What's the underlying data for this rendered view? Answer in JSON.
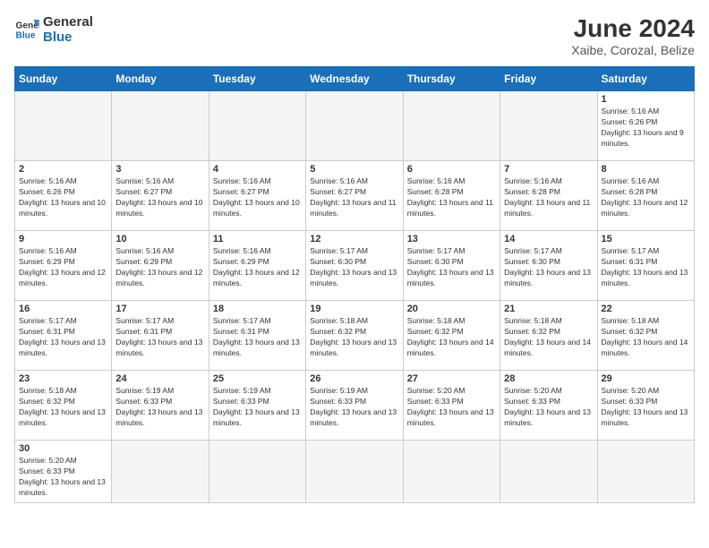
{
  "logo": {
    "line1": "General",
    "line2": "Blue"
  },
  "title": "June 2024",
  "subtitle": "Xaibe, Corozal, Belize",
  "weekdays": [
    "Sunday",
    "Monday",
    "Tuesday",
    "Wednesday",
    "Thursday",
    "Friday",
    "Saturday"
  ],
  "weeks": [
    [
      {
        "day": "",
        "empty": true
      },
      {
        "day": "",
        "empty": true
      },
      {
        "day": "",
        "empty": true
      },
      {
        "day": "",
        "empty": true
      },
      {
        "day": "",
        "empty": true
      },
      {
        "day": "",
        "empty": true
      },
      {
        "day": "1",
        "sunrise": "5:16 AM",
        "sunset": "6:26 PM",
        "daylight": "13 hours and 9 minutes."
      }
    ],
    [
      {
        "day": "2",
        "sunrise": "5:16 AM",
        "sunset": "6:26 PM",
        "daylight": "13 hours and 10 minutes."
      },
      {
        "day": "3",
        "sunrise": "5:16 AM",
        "sunset": "6:27 PM",
        "daylight": "13 hours and 10 minutes."
      },
      {
        "day": "4",
        "sunrise": "5:16 AM",
        "sunset": "6:27 PM",
        "daylight": "13 hours and 10 minutes."
      },
      {
        "day": "5",
        "sunrise": "5:16 AM",
        "sunset": "6:27 PM",
        "daylight": "13 hours and 11 minutes."
      },
      {
        "day": "6",
        "sunrise": "5:16 AM",
        "sunset": "6:28 PM",
        "daylight": "13 hours and 11 minutes."
      },
      {
        "day": "7",
        "sunrise": "5:16 AM",
        "sunset": "6:28 PM",
        "daylight": "13 hours and 11 minutes."
      },
      {
        "day": "8",
        "sunrise": "5:16 AM",
        "sunset": "6:28 PM",
        "daylight": "13 hours and 12 minutes."
      }
    ],
    [
      {
        "day": "9",
        "sunrise": "5:16 AM",
        "sunset": "6:29 PM",
        "daylight": "13 hours and 12 minutes."
      },
      {
        "day": "10",
        "sunrise": "5:16 AM",
        "sunset": "6:29 PM",
        "daylight": "13 hours and 12 minutes."
      },
      {
        "day": "11",
        "sunrise": "5:16 AM",
        "sunset": "6:29 PM",
        "daylight": "13 hours and 12 minutes."
      },
      {
        "day": "12",
        "sunrise": "5:17 AM",
        "sunset": "6:30 PM",
        "daylight": "13 hours and 13 minutes."
      },
      {
        "day": "13",
        "sunrise": "5:17 AM",
        "sunset": "6:30 PM",
        "daylight": "13 hours and 13 minutes."
      },
      {
        "day": "14",
        "sunrise": "5:17 AM",
        "sunset": "6:30 PM",
        "daylight": "13 hours and 13 minutes."
      },
      {
        "day": "15",
        "sunrise": "5:17 AM",
        "sunset": "6:31 PM",
        "daylight": "13 hours and 13 minutes."
      }
    ],
    [
      {
        "day": "16",
        "sunrise": "5:17 AM",
        "sunset": "6:31 PM",
        "daylight": "13 hours and 13 minutes."
      },
      {
        "day": "17",
        "sunrise": "5:17 AM",
        "sunset": "6:31 PM",
        "daylight": "13 hours and 13 minutes."
      },
      {
        "day": "18",
        "sunrise": "5:17 AM",
        "sunset": "6:31 PM",
        "daylight": "13 hours and 13 minutes."
      },
      {
        "day": "19",
        "sunrise": "5:18 AM",
        "sunset": "6:32 PM",
        "daylight": "13 hours and 13 minutes."
      },
      {
        "day": "20",
        "sunrise": "5:18 AM",
        "sunset": "6:32 PM",
        "daylight": "13 hours and 14 minutes."
      },
      {
        "day": "21",
        "sunrise": "5:18 AM",
        "sunset": "6:32 PM",
        "daylight": "13 hours and 14 minutes."
      },
      {
        "day": "22",
        "sunrise": "5:18 AM",
        "sunset": "6:32 PM",
        "daylight": "13 hours and 14 minutes."
      }
    ],
    [
      {
        "day": "23",
        "sunrise": "5:18 AM",
        "sunset": "6:32 PM",
        "daylight": "13 hours and 13 minutes."
      },
      {
        "day": "24",
        "sunrise": "5:19 AM",
        "sunset": "6:33 PM",
        "daylight": "13 hours and 13 minutes."
      },
      {
        "day": "25",
        "sunrise": "5:19 AM",
        "sunset": "6:33 PM",
        "daylight": "13 hours and 13 minutes."
      },
      {
        "day": "26",
        "sunrise": "5:19 AM",
        "sunset": "6:33 PM",
        "daylight": "13 hours and 13 minutes."
      },
      {
        "day": "27",
        "sunrise": "5:20 AM",
        "sunset": "6:33 PM",
        "daylight": "13 hours and 13 minutes."
      },
      {
        "day": "28",
        "sunrise": "5:20 AM",
        "sunset": "6:33 PM",
        "daylight": "13 hours and 13 minutes."
      },
      {
        "day": "29",
        "sunrise": "5:20 AM",
        "sunset": "6:33 PM",
        "daylight": "13 hours and 13 minutes."
      }
    ],
    [
      {
        "day": "30",
        "sunrise": "5:20 AM",
        "sunset": "6:33 PM",
        "daylight": "13 hours and 13 minutes."
      },
      {
        "day": "",
        "empty": true
      },
      {
        "day": "",
        "empty": true
      },
      {
        "day": "",
        "empty": true
      },
      {
        "day": "",
        "empty": true
      },
      {
        "day": "",
        "empty": true
      },
      {
        "day": "",
        "empty": true
      }
    ]
  ]
}
